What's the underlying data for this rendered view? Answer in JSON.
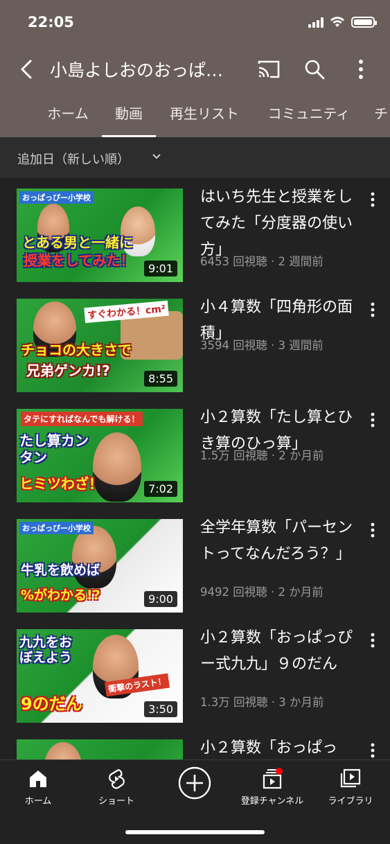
{
  "status_bar": {
    "time": "22:05"
  },
  "app_bar": {
    "channel_title": "小島よしおのおっぱ…"
  },
  "tabs": [
    {
      "label": "ホーム"
    },
    {
      "label": "動画"
    },
    {
      "label": "再生リスト"
    },
    {
      "label": "コミュニティ"
    },
    {
      "label": "チ"
    }
  ],
  "sort": {
    "label": "追加日（新しい順）"
  },
  "videos": [
    {
      "title": "はいち先生と授業をしてみた「分度器の使い方」",
      "meta": "6453 回視聴 · 2 週間前",
      "duration": "9:01",
      "thumb_text_1": "とある男と一緒に",
      "thumb_text_2": "授業をしてみた！",
      "thumb_tag": "おっぱっぴー小学校"
    },
    {
      "title": "小４算数「四角形の面積」",
      "meta": "3594 回視聴 · 3 週間前",
      "duration": "8:55",
      "thumb_text_1": "チョコの大きさで",
      "thumb_text_2": "兄弟ゲンカ!?",
      "thumb_tag": "すぐわかる！cm²"
    },
    {
      "title": "小２算数「たし算とひき算のひっ算」",
      "meta": "1.5万 回視聴 · 2 か月前",
      "duration": "7:02",
      "thumb_text_1": "たし算カンタン",
      "thumb_text_2": "ヒミツわざ！",
      "thumb_tag": "タテにすればなんでも解ける！"
    },
    {
      "title": "全学年算数「パーセントってなんだろう？」",
      "meta": "9492 回視聴 · 2 か月前",
      "duration": "9:00",
      "thumb_text_1": "牛乳を飲めば",
      "thumb_text_2": "%がわかる!?",
      "thumb_tag": "おっぱっぴー小学校"
    },
    {
      "title": "小２算数「おっぱっぴー式九九」９のだん",
      "meta": "1.3万 回視聴 · 3 か月前",
      "duration": "3:50",
      "thumb_text_1": "九九をおぼえよう",
      "thumb_text_2": "9のだん",
      "thumb_tag": "衝撃のラスト！"
    },
    {
      "title": "小２算数「おっぱっ",
      "meta": "",
      "duration": "",
      "thumb_text_1": "",
      "thumb_text_2": "",
      "thumb_tag": ""
    }
  ],
  "bottom_nav": [
    {
      "label": "ホーム",
      "icon": "home-icon"
    },
    {
      "label": "ショート",
      "icon": "shorts-icon"
    },
    {
      "label": "",
      "icon": "create-icon"
    },
    {
      "label": "登録チャンネル",
      "icon": "subscriptions-icon"
    },
    {
      "label": "ライブラリ",
      "icon": "library-icon"
    }
  ],
  "colors": {
    "header_bg": "#6a5e5a",
    "page_bg": "#222222",
    "notification_dot": "#ff0000"
  }
}
